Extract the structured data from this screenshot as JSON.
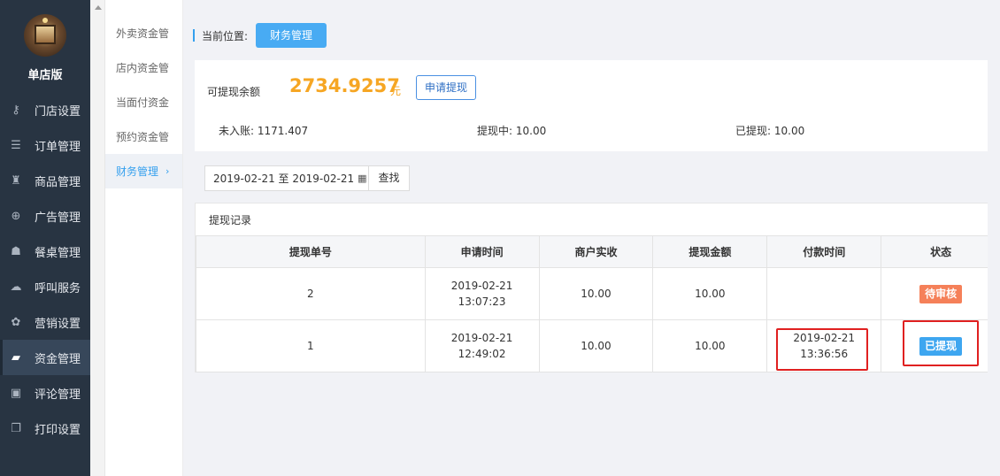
{
  "sidebar": {
    "shop_name": "单店版",
    "items": [
      {
        "label": "门店设置",
        "icon": "key-icon",
        "glyph": "⚷"
      },
      {
        "label": "订单管理",
        "icon": "list-icon",
        "glyph": "☰"
      },
      {
        "label": "商品管理",
        "icon": "trophy-icon",
        "glyph": "♜"
      },
      {
        "label": "广告管理",
        "icon": "lifebuoy-icon",
        "glyph": "⊕"
      },
      {
        "label": "餐桌管理",
        "icon": "binoculars-icon",
        "glyph": "☗"
      },
      {
        "label": "呼叫服务",
        "icon": "cloud-icon",
        "glyph": "☁"
      },
      {
        "label": "营销设置",
        "icon": "gift-icon",
        "glyph": "✿"
      },
      {
        "label": "资金管理",
        "icon": "book-icon",
        "glyph": "▰",
        "active": true
      },
      {
        "label": "评论管理",
        "icon": "money-icon",
        "glyph": "▣"
      },
      {
        "label": "打印设置",
        "icon": "copy-icon",
        "glyph": "❐"
      }
    ]
  },
  "submenu": {
    "items": [
      {
        "label": "外卖资金管"
      },
      {
        "label": "店内资金管"
      },
      {
        "label": "当面付资金"
      },
      {
        "label": "预约资金管"
      },
      {
        "label": "财务管理",
        "active": true,
        "chevron": "›"
      }
    ]
  },
  "breadcrumb": {
    "label": "当前位置:",
    "current": "财务管理"
  },
  "balance": {
    "label": "可提现余额",
    "amount": "2734.9257",
    "unit": "元",
    "withdraw_button": "申请提现",
    "pending_entry": "未入账: 1171.407",
    "withdrawing": "提现中: 10.00",
    "withdrawn": "已提现: 10.00"
  },
  "filter": {
    "date_range": "2019-02-21 至 2019-02-21",
    "calendar_icon": "calendar-icon",
    "search_button": "查找"
  },
  "records": {
    "title": "提现记录",
    "columns": [
      "提现单号",
      "申请时间",
      "商户实收",
      "提现金额",
      "付款时间",
      "状态"
    ],
    "rows": [
      {
        "id": "2",
        "apply_date": "2019-02-21",
        "apply_time": "13:07:23",
        "received": "10.00",
        "amount": "10.00",
        "pay_date": "",
        "pay_time": "",
        "status": "待审核",
        "status_type": "pending"
      },
      {
        "id": "1",
        "apply_date": "2019-02-21",
        "apply_time": "12:49:02",
        "received": "10.00",
        "amount": "10.00",
        "pay_date": "2019-02-21",
        "pay_time": "13:36:56",
        "status": "已提现",
        "status_type": "done"
      }
    ]
  },
  "colors": {
    "sidebar_bg": "#283442",
    "accent_blue": "#48abf3",
    "amount_orange": "#f6a623",
    "pending_badge": "#f58059",
    "done_badge": "#3ea6f0",
    "highlight_red": "#e02020"
  }
}
